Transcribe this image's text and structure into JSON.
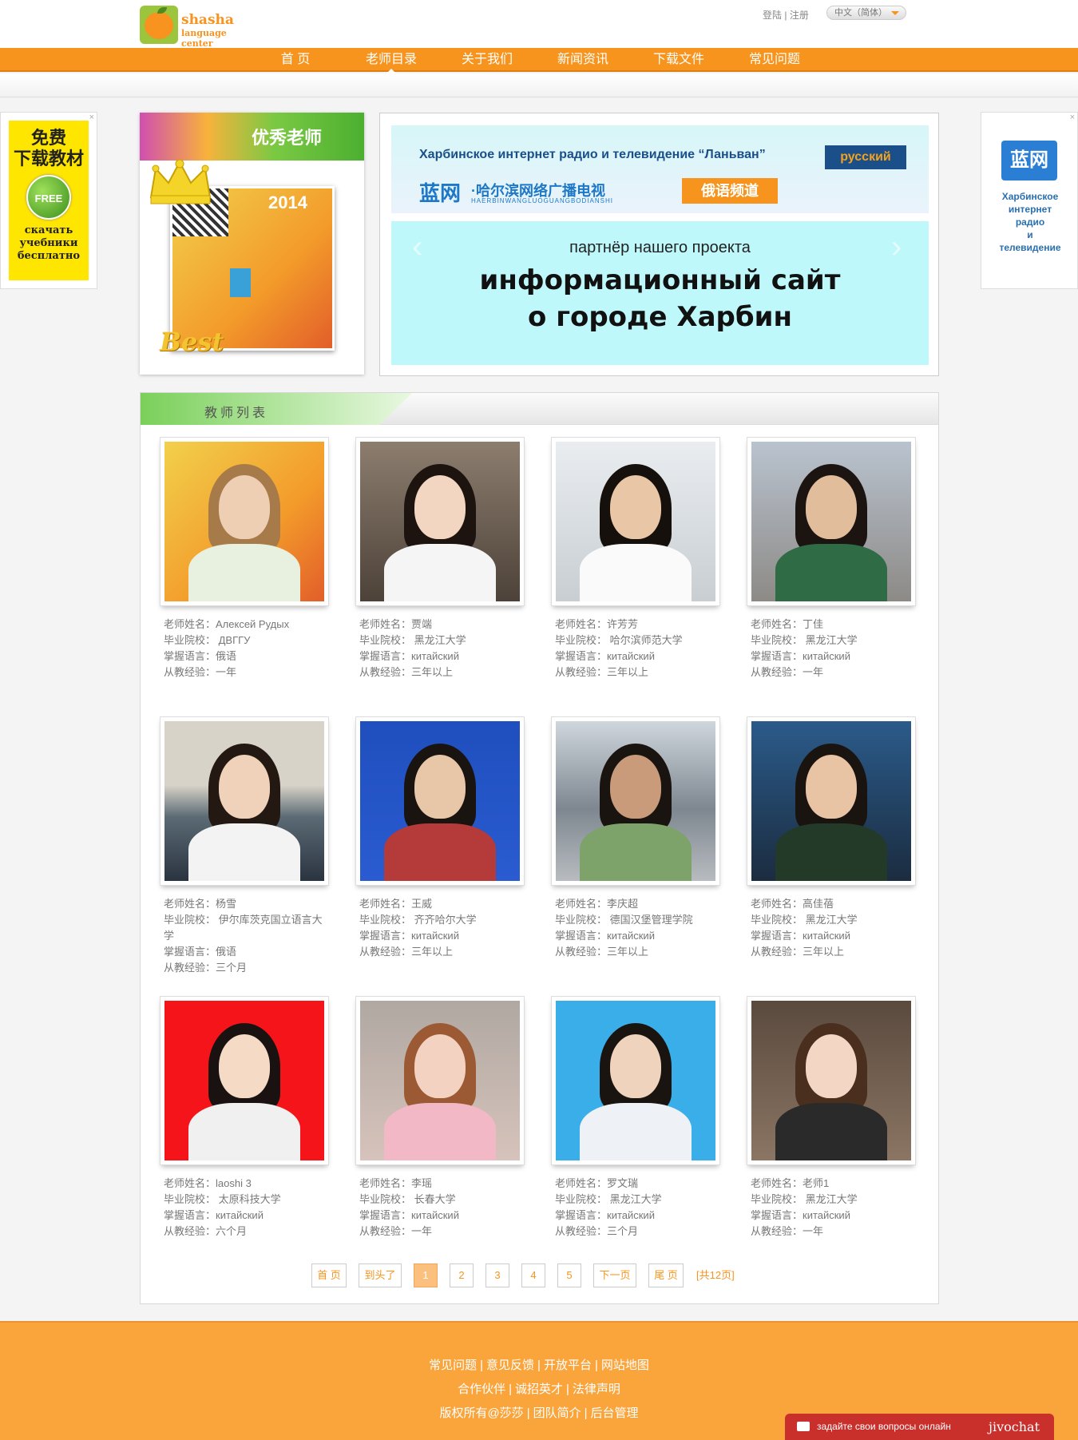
{
  "header": {
    "logo_name": "shasha",
    "logo_sub": "language center",
    "login": "登陆",
    "separator": "|",
    "register": "注册",
    "language": "中文（简体）"
  },
  "nav": {
    "items": [
      "首 页",
      "老师目录",
      "关于我们",
      "新闻资讯",
      "下载文件",
      "常见问题"
    ],
    "active": "老师目录"
  },
  "ads": {
    "left_title_1": "免费",
    "left_title_2": "下载教材",
    "left_badge": "FREE",
    "left_ru_1": "скачать",
    "left_ru_2": "учебники",
    "left_ru_3": "бесплатно",
    "right_logo": "蓝网",
    "right_text_1": "Харбинское",
    "right_text_2": "интернет",
    "right_text_3": "радио",
    "right_text_4": "и",
    "right_text_5": "телевидение",
    "close": "×"
  },
  "best": {
    "title": "优秀老师",
    "badge": "Best"
  },
  "banner": {
    "ru_line": "Харбинское интернет радио и телевидение “Ланьван”",
    "ru_tag": "русский",
    "logo": "蓝网",
    "cn_name": "·哈尔滨网络广播电视",
    "cn_pinyin": "HAERBINWANGLUOGUANGBODIANSHI",
    "cn_channel": "俄语频道",
    "partner": "партнёр нашего проекта",
    "big_1": "информационный сайт",
    "big_2": "о городе Харбин"
  },
  "list": {
    "title": "教师列表",
    "teachers": [
      {
        "name": "老师姓名：Алексей Рудых",
        "school": "毕业院校： ДВГГУ",
        "lang": "掌握语言：俄语",
        "exp": "从教经验：一年"
      },
      {
        "name": "老师姓名：贾端",
        "school": "毕业院校： 黑龙江大学",
        "lang": "掌握语言：китайский",
        "exp": "从教经验：三年以上"
      },
      {
        "name": "老师姓名：许芳芳",
        "school": "毕业院校： 哈尔滨师范大学",
        "lang": "掌握语言：китайский",
        "exp": "从教经验：三年以上"
      },
      {
        "name": "老师姓名：丁佳",
        "school": "毕业院校： 黑龙江大学",
        "lang": "掌握语言：китайский",
        "exp": "从教经验：一年"
      },
      {
        "name": "老师姓名：杨雪",
        "school": "毕业院校： 伊尔库茨克国立语言大学",
        "lang": "掌握语言：俄语",
        "exp": "从教经验：三个月"
      },
      {
        "name": "老师姓名：王威",
        "school": "毕业院校： 齐齐哈尔大学",
        "lang": "掌握语言：китайский",
        "exp": "从教经验：三年以上"
      },
      {
        "name": "老师姓名：李庆超",
        "school": "毕业院校： 德国汉堡管理学院",
        "lang": "掌握语言：китайский",
        "exp": "从教经验：三年以上"
      },
      {
        "name": "老师姓名：高佳蓓",
        "school": "毕业院校： 黑龙江大学",
        "lang": "掌握语言：китайский",
        "exp": "从教经验：三年以上"
      },
      {
        "name": "老师姓名：laoshi 3",
        "school": "毕业院校： 太原科技大学",
        "lang": "掌握语言：китайский",
        "exp": "从教经验：六个月"
      },
      {
        "name": "老师姓名：李瑶",
        "school": "毕业院校： 长春大学",
        "lang": "掌握语言：китайский",
        "exp": "从教经验：一年"
      },
      {
        "name": "老师姓名：罗文瑞",
        "school": "毕业院校： 黑龙江大学",
        "lang": "掌握语言：китайский",
        "exp": "从教经验：三个月"
      },
      {
        "name": "老师姓名：老师1",
        "school": "毕业院校： 黑龙江大学",
        "lang": "掌握语言：китайский",
        "exp": "从教经验：一年"
      }
    ]
  },
  "pager": {
    "first": "首 页",
    "to_top": "到头了",
    "pages": [
      "1",
      "2",
      "3",
      "4",
      "5"
    ],
    "current": "1",
    "next": "下一页",
    "last": "尾 页",
    "total": "[共12页]"
  },
  "footer": {
    "line1": [
      "常见问题",
      "意见反馈",
      "开放平台",
      "网站地图"
    ],
    "line2": [
      "合作伙伴",
      "诚招英才",
      "法律声明"
    ],
    "line3": [
      "版权所有@莎莎",
      "团队简介",
      "后台管理"
    ],
    "sep": "|"
  },
  "chat": {
    "text": "задайте свои вопросы онлайн",
    "brand": "jivochat"
  },
  "colors": {
    "accent": "#f7941d",
    "footer": "#faa43c",
    "chat": "#c9302c"
  }
}
